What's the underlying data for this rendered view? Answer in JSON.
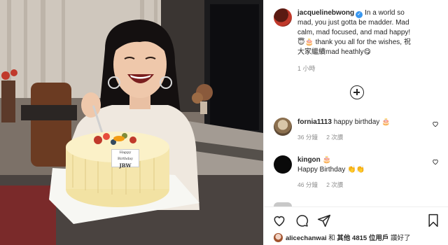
{
  "post": {
    "author": "jacquelinebwong",
    "caption_lines": [
      "In a world so",
      "mad, you just gotta be madder. Mad",
      "calm, mad focused, and mad happy!",
      "thank you all for the wishes, 祝",
      "大家繼續mad heathly"
    ],
    "caption_emojis": [
      "😇",
      "🎂",
      "😋"
    ],
    "time": "1 小時",
    "photo": {
      "cake_topper_line1": "Happy Birthday",
      "cake_topper_line2": "JBW"
    }
  },
  "comments": [
    {
      "username": "fornia1113",
      "text": "happy birthday",
      "emoji": "🎂",
      "time": "36 分鐘",
      "likes": "2 次讚"
    },
    {
      "username": "kingon",
      "username_suffix": "🎂",
      "text": "Happy Birthday",
      "emoji": "👏👏",
      "time": "46 分鐘",
      "likes": "2 次讚"
    }
  ],
  "actions": {
    "like_icon": "heart-icon",
    "comment_icon": "comment-icon",
    "share_icon": "share-icon",
    "save_icon": "bookmark-icon"
  },
  "likes": {
    "user": "alicechanwai",
    "and": "和",
    "others_label": "其他 4815 位用戶",
    "suffix": "讚好了"
  },
  "colors": {
    "verified": "#3897f0",
    "muted_text": "#8e8e8e",
    "divider": "#efefef"
  }
}
